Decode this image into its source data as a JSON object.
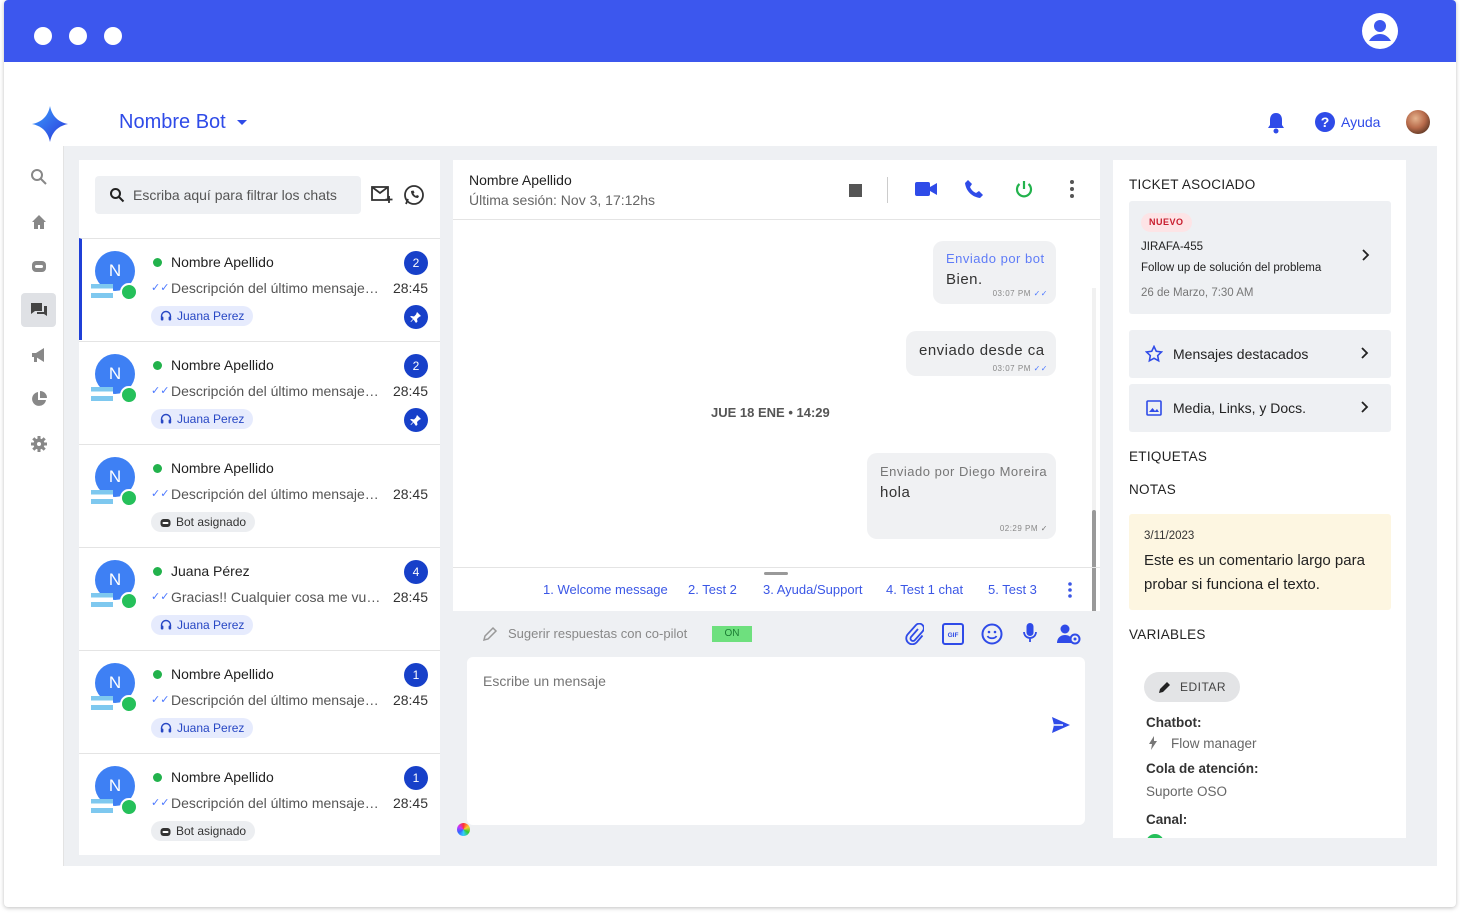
{
  "header": {
    "bot_name": "Nombre Bot",
    "help_label": "Ayuda"
  },
  "chat_list": {
    "search_placeholder": "Escriba aquí para filtrar los chats",
    "items": [
      {
        "initial": "N",
        "name": "Nombre Apellido",
        "desc": "Descripción del último mensaje del chat",
        "time": "28:45",
        "badge": "2",
        "tag": "Juana Perez",
        "tag_type": "agent",
        "pinned": true,
        "selected": true
      },
      {
        "initial": "N",
        "name": "Nombre Apellido",
        "desc": "Descripción del último mensaje del chat",
        "time": "28:45",
        "badge": "2",
        "tag": "Juana Perez",
        "tag_type": "agent",
        "pinned": true,
        "selected": false
      },
      {
        "initial": "N",
        "name": "Nombre Apellido",
        "desc": "Descripción del último mensaje del chat",
        "time": "28:45",
        "badge": "",
        "tag": "Bot asignado",
        "tag_type": "bot",
        "pinned": false,
        "selected": false
      },
      {
        "initial": "N",
        "name": "Juana Pérez",
        "desc": "Gracias!! Cualquier cosa me vuelvo a comunicar",
        "time": "28:45",
        "badge": "4",
        "tag": "Juana Perez",
        "tag_type": "agent",
        "pinned": false,
        "selected": false
      },
      {
        "initial": "N",
        "name": "Nombre Apellido",
        "desc": "Descripción del último mensaje del chat",
        "time": "28:45",
        "badge": "1",
        "tag": "Juana Perez",
        "tag_type": "agent",
        "pinned": false,
        "selected": false
      },
      {
        "initial": "N",
        "name": "Nombre Apellido",
        "desc": "Descripción del último mensaje del chat",
        "time": "28:45",
        "badge": "1",
        "tag": "Bot asignado",
        "tag_type": "bot",
        "pinned": false,
        "selected": false
      }
    ]
  },
  "conversation": {
    "contact_name": "Nombre Apellido",
    "last_session": "Última sesión: Nov 3, 17:12hs",
    "messages": [
      {
        "tag": "Enviado por bot",
        "text": "Bien.",
        "time": "03:07 PM"
      },
      {
        "tag": "",
        "text": "enviado desde ca",
        "time": "03:07 PM"
      },
      {
        "tag": "Enviado por Diego Moreira",
        "text": "hola",
        "time": "02:29 PM"
      }
    ],
    "date_separator": "JUE 18 ENE • 14:29",
    "quick_replies": [
      "1. Welcome message",
      "2. Test 2",
      "3. Ayuda/Support",
      "4. Test 1 chat",
      "5. Test 3"
    ],
    "copilot_label": "Sugerir respuestas con co-pilot",
    "copilot_state": "ON",
    "compose_placeholder": "Escribe un mensaje"
  },
  "right_panel": {
    "ticket_title": "TICKET ASOCIADO",
    "ticket": {
      "status": "NUEVO",
      "id": "JIRAFA-455",
      "summary": "Follow up de solución del problema",
      "date": "26 de Marzo, 7:30 AM"
    },
    "starred_label": "Mensajes destacados",
    "media_label": "Media, Links, y Docs.",
    "tags_title": "ETIQUETAS",
    "notes_title": "NOTAS",
    "note": {
      "date": "3/11/2023",
      "text": "Este es un comentario largo para probar si funciona el texto."
    },
    "variables_title": "VARIABLES",
    "edit_label": "EDITAR",
    "chatbot_label": "Chatbot:",
    "chatbot_value": "Flow manager",
    "queue_label": "Cola de atención:",
    "queue_value": "Suporte OSO",
    "channel_label": "Canal:"
  },
  "colors": {
    "primary": "#3c57ee",
    "accent_dark": "#1740c9",
    "online": "#22b24c",
    "whatsapp": "#25c05a"
  }
}
